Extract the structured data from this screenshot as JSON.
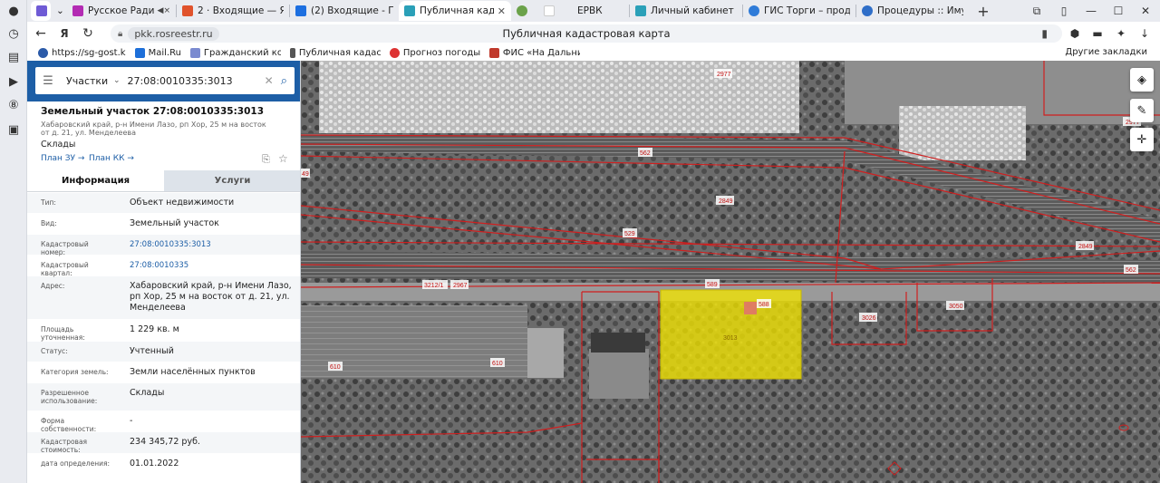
{
  "browser": {
    "tabs": [
      {
        "label": "",
        "fav": "#6f5bd5",
        "kind": "sound-tab"
      },
      {
        "label": "Русское Радио —",
        "fav": "#b32bb3",
        "sound": "◀×"
      },
      {
        "label": "2 · Входящие — Яндекс",
        "fav": "#e0522b"
      },
      {
        "label": "(2) Входящие - Почта М",
        "fav": "#1d6fe0"
      },
      {
        "label": "Публичная кадастр",
        "fav": "#2aa0b8",
        "active": true
      },
      {
        "label": "",
        "fav": "#6ba24a"
      },
      {
        "label": "ЕРВК",
        "fav": "#ffffff"
      },
      {
        "label": "Личный кабинет",
        "fav": "#2aa0b8"
      },
      {
        "label": "ГИС Торги – продажи г",
        "fav": "#2f7bd8"
      },
      {
        "label": "Процедуры :: Имущест",
        "fav": "#2f6ec8"
      }
    ],
    "url": "pkk.rosreestr.ru",
    "page_title": "Публичная кадастровая карта",
    "bookmarks": [
      {
        "label": "https://sg-gost.k",
        "fav": "#2b5aa8"
      },
      {
        "label": "Mail.Ru",
        "fav": "#1e6fd9"
      },
      {
        "label": "Гражданский код",
        "fav": "#7a8ad0"
      },
      {
        "label": "Публичная кадас",
        "fav": "#555"
      },
      {
        "label": "Прогноз погоды",
        "fav": "#d33"
      },
      {
        "label": "ФИС «На Дальни",
        "fav": "#c0392b"
      }
    ],
    "other_bookmarks": "Другие закладки"
  },
  "panel": {
    "search_type": "Участки",
    "search_value": "27:08:0010335:3013",
    "title": "Земельный участок 27:08:0010335:3013",
    "address_short": "Хабаровский край, р-н Имени Лазо, рп Хор, 25 м на восток от д. 21, ул. Менделеева",
    "use": "Склады",
    "plan_zu": "План ЗУ →",
    "plan_kk": "План КК →",
    "tab_info": "Информация",
    "tab_services": "Услуги",
    "properties": [
      {
        "label": "Тип:",
        "value": "Объект недвижимости",
        "link": false
      },
      {
        "label": "Вид:",
        "value": "Земельный участок",
        "link": false
      },
      {
        "label": "Кадастровый номер:",
        "value": "27:08:0010335:3013",
        "link": true
      },
      {
        "label": "Кадастровый квартал:",
        "value": "27:08:0010335",
        "link": true
      },
      {
        "label": "Адрес:",
        "value": "Хабаровский край, р-н Имени Лазо, рп Хор, 25 м на восток от д. 21, ул. Менделеева",
        "link": false
      },
      {
        "label": "Площадь уточненная:",
        "value": "1 229 кв. м",
        "link": false
      },
      {
        "label": "Статус:",
        "value": "Учтенный",
        "link": false
      },
      {
        "label": "Категория земель:",
        "value": "Земли населённых пунктов",
        "link": false
      },
      {
        "label": "Разрешенное использование:",
        "value": "Склады",
        "link": false
      },
      {
        "label": "Форма собственности:",
        "value": "-",
        "link": false
      },
      {
        "label": "Кадастровая стоимость:",
        "value": "234 345,72 руб.",
        "link": false
      },
      {
        "label": "дата определения:",
        "value": "01.01.2022",
        "link": false
      }
    ]
  },
  "map": {
    "parcel_labels": [
      "2977",
      "2977",
      "562",
      "2849",
      "529",
      "2849",
      "562",
      "3212/1",
      "2967",
      "589",
      "588",
      "3013",
      "3026",
      "3050",
      "610",
      "610",
      "49"
    ],
    "highlight_color": "#f2e400",
    "boundary_color": "#d01f1f"
  }
}
